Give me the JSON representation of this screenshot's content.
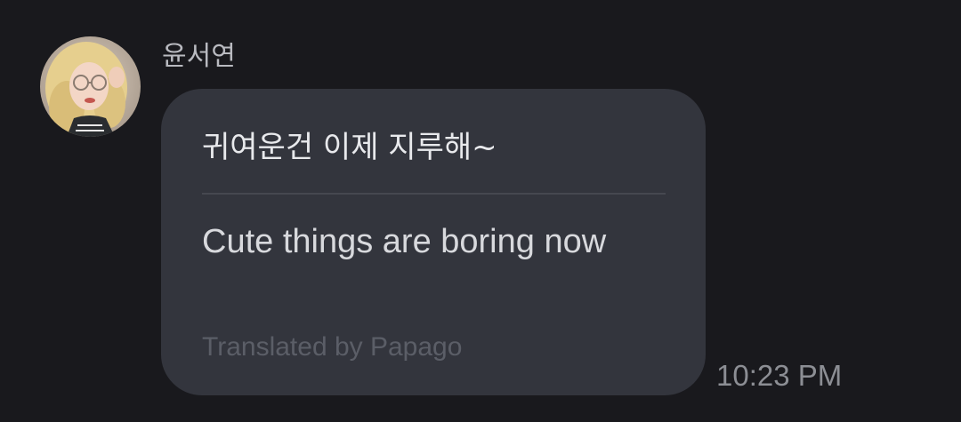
{
  "message": {
    "sender_name": "윤서연",
    "avatar": "sender-avatar-photo",
    "original_text": "귀여운건 이제 지루해~",
    "translated_text": "Cute things are boring now",
    "translation_credit": "Translated by Papago",
    "timestamp": "10:23 PM"
  },
  "colors": {
    "background": "#19191d",
    "bubble": "#33353d",
    "divider": "#464850",
    "primary_text": "#e8e9ec",
    "secondary_text": "#8c8e94",
    "muted_text": "#5b5e67"
  }
}
